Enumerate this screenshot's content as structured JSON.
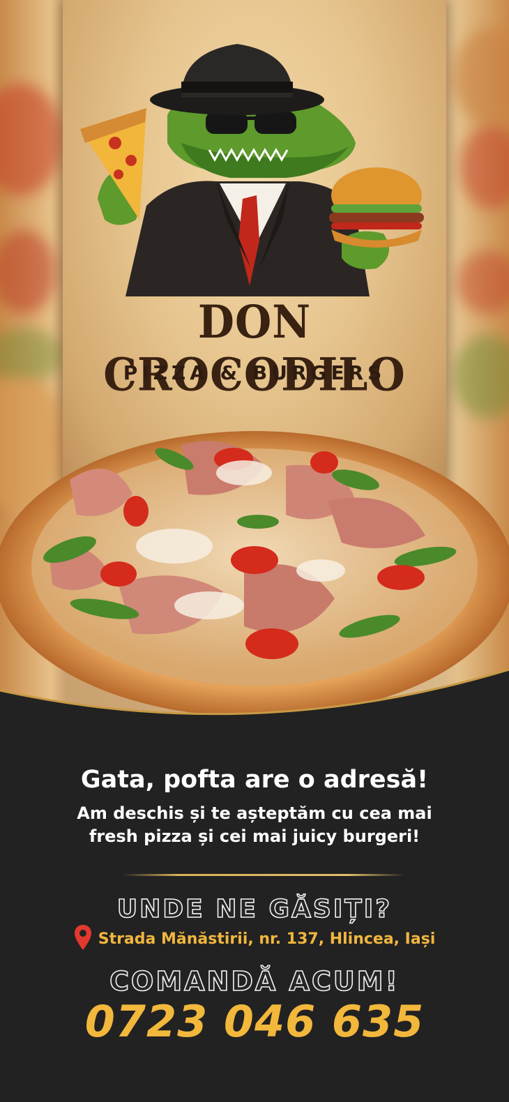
{
  "brand": {
    "name": "DON CROCODILO",
    "tagline": "PIZZA & BURGERS"
  },
  "promo": {
    "headline": "Gata, pofta are o adresă!",
    "intro_line1": "Am deschis și te așteptăm cu cea mai",
    "intro_line2": "fresh pizza și cei mai juicy burgeri!"
  },
  "location": {
    "title": "UNDE NE GĂSIȚI?",
    "icon": "map-pin-icon",
    "address": "Strada Mănăstirii, nr. 137, Hlincea, Iași"
  },
  "order": {
    "title": "COMANDĂ ACUM!",
    "phone": "0723 046 635"
  },
  "colors": {
    "background_dark": "#232222",
    "accent_gold": "#f2b83c",
    "brand_brown": "#3a2212",
    "pin_red": "#e2392f"
  }
}
